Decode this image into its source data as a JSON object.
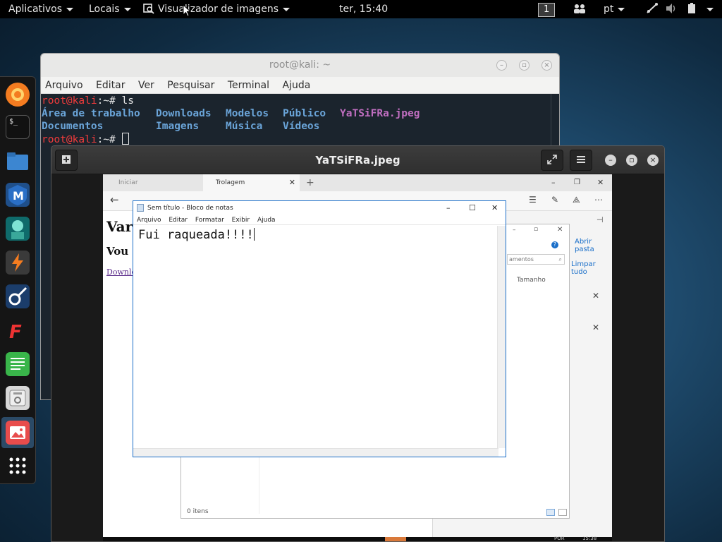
{
  "topbar": {
    "applications": "Aplicativos",
    "places": "Locais",
    "active_app": "Visualizador de imagens",
    "clock": "ter, 15:40",
    "workspace": "1",
    "language": "pt"
  },
  "terminal": {
    "title": "root@kali: ~",
    "menu": [
      "Arquivo",
      "Editar",
      "Ver",
      "Pesquisar",
      "Terminal",
      "Ajuda"
    ],
    "prompt_user": "root@kali",
    "prompt_path": ":~# ",
    "command": "ls",
    "ls_row1": [
      "Área de trabalho",
      "Downloads",
      "Modelos",
      "Público",
      "YaTSiFRa.jpeg"
    ],
    "ls_row2": [
      "Documentos",
      "Imagens",
      "Música",
      "Vídeos"
    ]
  },
  "viewer": {
    "title": "YaTSiFRa.jpeg"
  },
  "photo": {
    "tab1": "Iniciar",
    "tab2": "Trolagem",
    "page_heading": "Var",
    "page_sub": "Vou",
    "page_link": "Downlo",
    "open_folder": "Abrir pasta",
    "clear_all": "Limpar tudo",
    "search_placeholder": "amentos",
    "col_size": "Tamanho",
    "items_count": "0 itens",
    "taskbar_lang": "POR",
    "taskbar_time": "15:38"
  },
  "notepad": {
    "title": "Sem título - Bloco de notas",
    "menu": [
      "Arquivo",
      "Editar",
      "Formatar",
      "Exibir",
      "Ajuda"
    ],
    "content": "Fui raqueada!!!!"
  },
  "colors": {
    "terminal_bg": "#1b242d",
    "prompt_red": "#ef3b3b",
    "dir_blue": "#6aa4d8",
    "file_purple": "#c06ec0",
    "notepad_border": "#1c6fc9"
  }
}
